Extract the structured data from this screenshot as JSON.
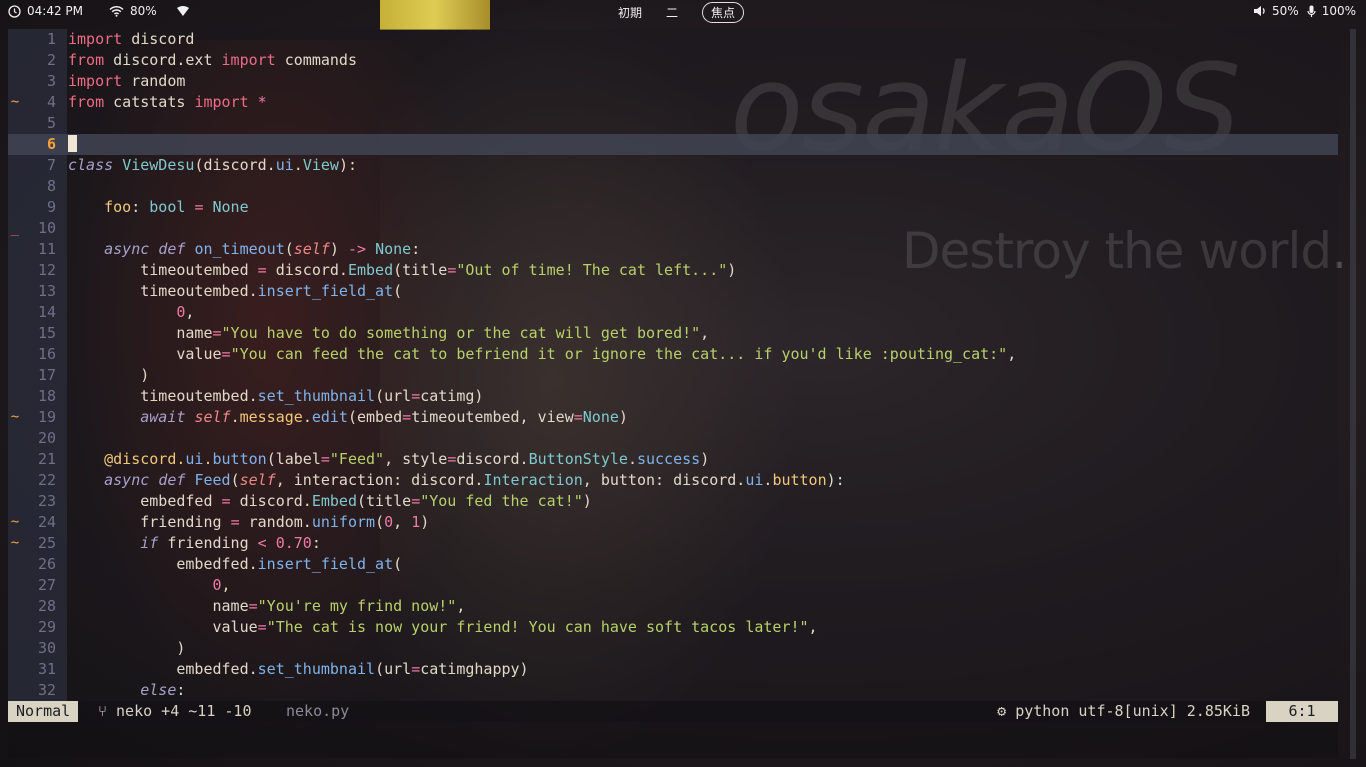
{
  "topbar": {
    "time": "04:42 PM",
    "wifi": "80%",
    "workspace_1": "初期",
    "workspace_2": "二",
    "workspace_3": "焦点",
    "volume": "50%",
    "mic": "100%"
  },
  "background": {
    "title": "osakaOS",
    "tagline": "Destroy the world."
  },
  "editor": {
    "current_line": 6,
    "lines": [
      {
        "n": "1",
        "sign": ""
      },
      {
        "n": "2",
        "sign": ""
      },
      {
        "n": "3",
        "sign": ""
      },
      {
        "n": "4",
        "sign": "~"
      },
      {
        "n": "5",
        "sign": ""
      },
      {
        "n": "6",
        "sign": ""
      },
      {
        "n": "7",
        "sign": ""
      },
      {
        "n": "8",
        "sign": ""
      },
      {
        "n": "9",
        "sign": ""
      },
      {
        "n": "10",
        "sign": "_"
      },
      {
        "n": "11",
        "sign": ""
      },
      {
        "n": "12",
        "sign": ""
      },
      {
        "n": "13",
        "sign": ""
      },
      {
        "n": "14",
        "sign": ""
      },
      {
        "n": "15",
        "sign": ""
      },
      {
        "n": "16",
        "sign": ""
      },
      {
        "n": "17",
        "sign": ""
      },
      {
        "n": "18",
        "sign": ""
      },
      {
        "n": "19",
        "sign": "~"
      },
      {
        "n": "20",
        "sign": ""
      },
      {
        "n": "21",
        "sign": ""
      },
      {
        "n": "22",
        "sign": ""
      },
      {
        "n": "23",
        "sign": ""
      },
      {
        "n": "24",
        "sign": "~"
      },
      {
        "n": "25",
        "sign": "~"
      },
      {
        "n": "26",
        "sign": ""
      },
      {
        "n": "27",
        "sign": ""
      },
      {
        "n": "28",
        "sign": ""
      },
      {
        "n": "29",
        "sign": ""
      },
      {
        "n": "30",
        "sign": ""
      },
      {
        "n": "31",
        "sign": ""
      },
      {
        "n": "32",
        "sign": ""
      }
    ],
    "code": [
      [
        [
          "k",
          "import"
        ],
        [
          "p",
          " discord"
        ]
      ],
      [
        [
          "k",
          "from"
        ],
        [
          "p",
          " discord.ext "
        ],
        [
          "k",
          "import"
        ],
        [
          "p",
          " commands"
        ]
      ],
      [
        [
          "k",
          "import"
        ],
        [
          "p",
          " random"
        ]
      ],
      [
        [
          "k",
          "from"
        ],
        [
          "p",
          " catstats "
        ],
        [
          "k",
          "import"
        ],
        [
          "p",
          " "
        ],
        [
          "n",
          "*"
        ]
      ],
      [],
      [],
      [
        [
          "ki",
          "class"
        ],
        [
          "p",
          " "
        ],
        [
          "ty",
          "ViewDesu"
        ],
        [
          "p",
          "(discord."
        ],
        [
          "f",
          "ui"
        ],
        [
          "p",
          "."
        ],
        [
          "ty",
          "View"
        ],
        [
          "p",
          "):"
        ]
      ],
      [],
      [
        [
          "p",
          "    "
        ],
        [
          "d",
          "foo"
        ],
        [
          "p",
          ": "
        ],
        [
          "ty",
          "bool"
        ],
        [
          "p",
          " "
        ],
        [
          "n",
          "="
        ],
        [
          "p",
          " "
        ],
        [
          "ty",
          "None"
        ]
      ],
      [],
      [
        [
          "p",
          "    "
        ],
        [
          "ki",
          "async"
        ],
        [
          "p",
          " "
        ],
        [
          "ki",
          "def"
        ],
        [
          "p",
          " "
        ],
        [
          "f",
          "on_timeout"
        ],
        [
          "p",
          "("
        ],
        [
          "kr",
          "self"
        ],
        [
          "p",
          ") "
        ],
        [
          "n",
          "->"
        ],
        [
          "p",
          " "
        ],
        [
          "ty",
          "None"
        ],
        [
          "p",
          ":"
        ]
      ],
      [
        [
          "p",
          "        timeoutembed "
        ],
        [
          "n",
          "="
        ],
        [
          "p",
          " discord."
        ],
        [
          "ty",
          "Embed"
        ],
        [
          "p",
          "(title"
        ],
        [
          "n",
          "="
        ],
        [
          "s",
          "\"Out of time! The cat left...\""
        ],
        [
          "p",
          ")"
        ]
      ],
      [
        [
          "p",
          "        timeoutembed."
        ],
        [
          "f",
          "insert_field_at"
        ],
        [
          "p",
          "("
        ]
      ],
      [
        [
          "p",
          "            "
        ],
        [
          "n",
          "0"
        ],
        [
          "p",
          ","
        ]
      ],
      [
        [
          "p",
          "            name"
        ],
        [
          "n",
          "="
        ],
        [
          "s",
          "\"You have to do something or the cat will get bored!\""
        ],
        [
          "p",
          ","
        ]
      ],
      [
        [
          "p",
          "            value"
        ],
        [
          "n",
          "="
        ],
        [
          "s",
          "\"You can feed the cat to befriend it or ignore the cat... if you'd like :pouting_cat:\""
        ],
        [
          "p",
          ","
        ]
      ],
      [
        [
          "p",
          "        )"
        ]
      ],
      [
        [
          "p",
          "        timeoutembed."
        ],
        [
          "f",
          "set_thumbnail"
        ],
        [
          "p",
          "(url"
        ],
        [
          "n",
          "="
        ],
        [
          "p",
          "catimg)"
        ]
      ],
      [
        [
          "p",
          "        "
        ],
        [
          "ki",
          "await"
        ],
        [
          "p",
          " "
        ],
        [
          "kr",
          "self"
        ],
        [
          "p",
          "."
        ],
        [
          "d",
          "message"
        ],
        [
          "p",
          "."
        ],
        [
          "f",
          "edit"
        ],
        [
          "p",
          "(embed"
        ],
        [
          "n",
          "="
        ],
        [
          "p",
          "timeoutembed, view"
        ],
        [
          "n",
          "="
        ],
        [
          "ty",
          "None"
        ],
        [
          "p",
          ")"
        ]
      ],
      [],
      [
        [
          "p",
          "    "
        ],
        [
          "d",
          "@discord."
        ],
        [
          "f",
          "ui"
        ],
        [
          "d",
          "."
        ],
        [
          "f",
          "button"
        ],
        [
          "p",
          "(label"
        ],
        [
          "n",
          "="
        ],
        [
          "s",
          "\"Feed\""
        ],
        [
          "p",
          ", style"
        ],
        [
          "n",
          "="
        ],
        [
          "p",
          "discord."
        ],
        [
          "ty",
          "ButtonStyle"
        ],
        [
          "p",
          "."
        ],
        [
          "f",
          "success"
        ],
        [
          "p",
          ")"
        ]
      ],
      [
        [
          "p",
          "    "
        ],
        [
          "ki",
          "async"
        ],
        [
          "p",
          " "
        ],
        [
          "ki",
          "def"
        ],
        [
          "p",
          " "
        ],
        [
          "f",
          "Feed"
        ],
        [
          "p",
          "("
        ],
        [
          "kr",
          "self"
        ],
        [
          "p",
          ", interaction: discord."
        ],
        [
          "ty",
          "Interaction"
        ],
        [
          "p",
          ", button: discord."
        ],
        [
          "f",
          "ui"
        ],
        [
          "p",
          "."
        ],
        [
          "d",
          "button"
        ],
        [
          "p",
          "):"
        ]
      ],
      [
        [
          "p",
          "        embedfed "
        ],
        [
          "n",
          "="
        ],
        [
          "p",
          " discord."
        ],
        [
          "ty",
          "Embed"
        ],
        [
          "p",
          "(title"
        ],
        [
          "n",
          "="
        ],
        [
          "s",
          "\"You fed the cat!\""
        ],
        [
          "p",
          ")"
        ]
      ],
      [
        [
          "p",
          "        friending "
        ],
        [
          "n",
          "="
        ],
        [
          "p",
          " random."
        ],
        [
          "f",
          "uniform"
        ],
        [
          "p",
          "("
        ],
        [
          "n",
          "0"
        ],
        [
          "p",
          ", "
        ],
        [
          "n",
          "1"
        ],
        [
          "p",
          ")"
        ]
      ],
      [
        [
          "p",
          "        "
        ],
        [
          "ki",
          "if"
        ],
        [
          "p",
          " friending "
        ],
        [
          "n",
          "<"
        ],
        [
          "p",
          " "
        ],
        [
          "n",
          "0.70"
        ],
        [
          "p",
          ":"
        ]
      ],
      [
        [
          "p",
          "            embedfed."
        ],
        [
          "f",
          "insert_field_at"
        ],
        [
          "p",
          "("
        ]
      ],
      [
        [
          "p",
          "                "
        ],
        [
          "n",
          "0"
        ],
        [
          "p",
          ","
        ]
      ],
      [
        [
          "p",
          "                name"
        ],
        [
          "n",
          "="
        ],
        [
          "s",
          "\"You're my frind now!\""
        ],
        [
          "p",
          ","
        ]
      ],
      [
        [
          "p",
          "                value"
        ],
        [
          "n",
          "="
        ],
        [
          "s",
          "\"The cat is now your friend! You can have soft tacos later!\""
        ],
        [
          "p",
          ","
        ]
      ],
      [
        [
          "p",
          "            )"
        ]
      ],
      [
        [
          "p",
          "            embedfed."
        ],
        [
          "f",
          "set_thumbnail"
        ],
        [
          "p",
          "(url"
        ],
        [
          "n",
          "="
        ],
        [
          "p",
          "catimghappy)"
        ]
      ],
      [
        [
          "p",
          "        "
        ],
        [
          "ki",
          "else"
        ],
        [
          "p",
          ":"
        ]
      ]
    ]
  },
  "statusline": {
    "mode": "Normal",
    "branch": "neko +4 ~11 -10",
    "filename": "neko.py",
    "filetype": "python utf-8[unix] 2.85KiB",
    "position": "6:1"
  },
  "colors": {
    "sign_modified": "#f7a23d",
    "sign_deleted": "#e06060"
  }
}
